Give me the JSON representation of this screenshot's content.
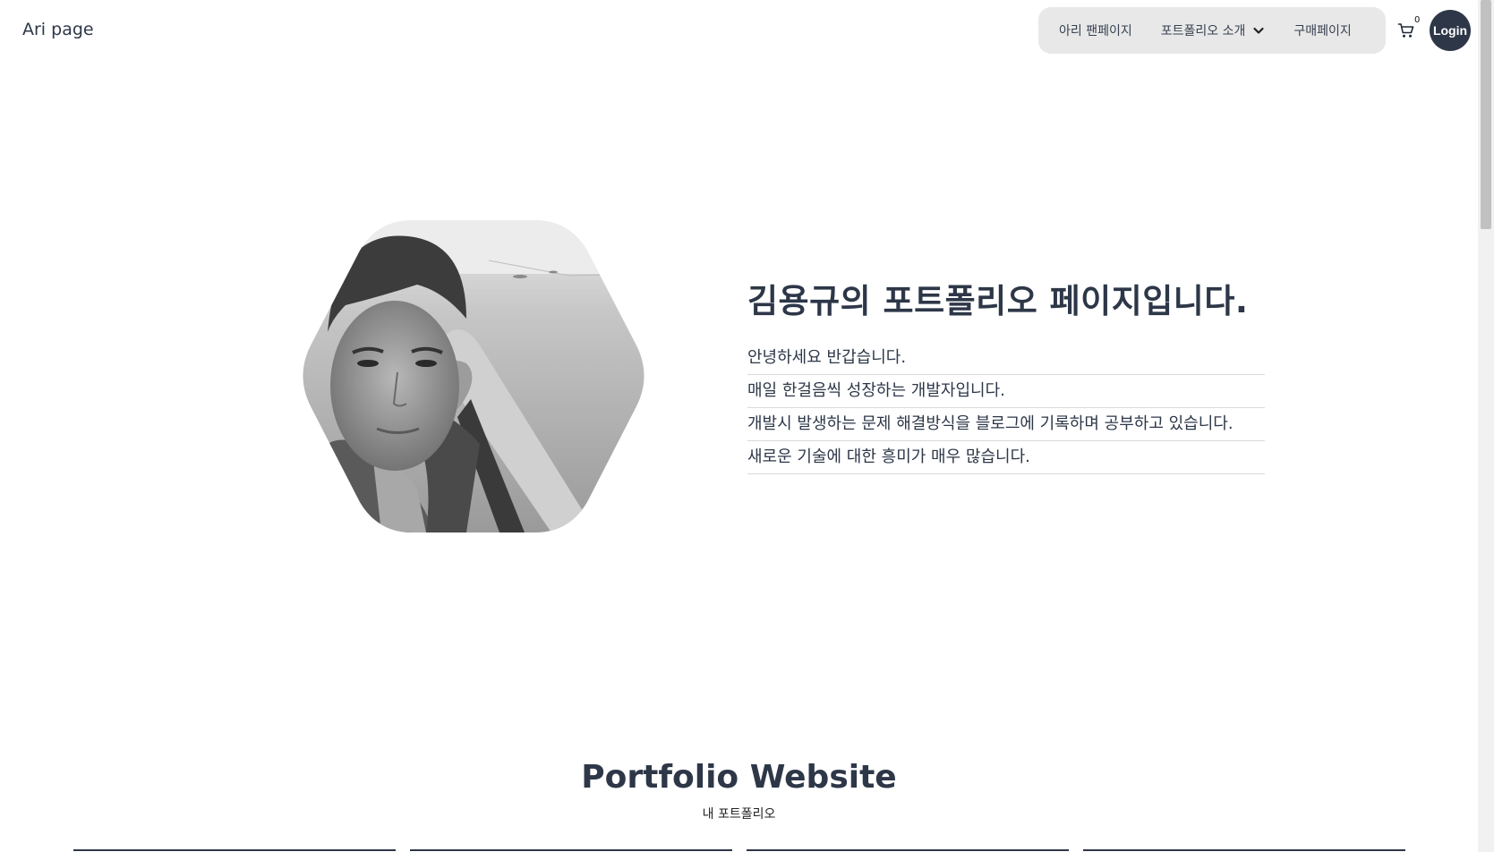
{
  "header": {
    "brand": "Ari page",
    "nav": [
      {
        "label": "아리 팬페이지"
      },
      {
        "label": "포트폴리오 소개",
        "has_dropdown": true
      },
      {
        "label": "구매페이지"
      }
    ],
    "cart_count": "0",
    "login_label": "Login"
  },
  "hero": {
    "title": "김용규의 포트폴리오 페이지입니다.",
    "lines": [
      "안녕하세요 반갑습니다.",
      "매일 한걸음씩 성장하는 개발자입니다.",
      "개발시 발생하는 문제 해결방식을 블로그에 기록하며 공부하고 있습니다.",
      "새로운 기술에 대한 흥미가 매우 많습니다."
    ]
  },
  "portfolio": {
    "title": "Portfolio Website",
    "subtitle": "내 포트폴리오"
  },
  "colors": {
    "text": "#2d3748",
    "nav_bg": "#e8e8e8",
    "login_bg": "#2d3748"
  }
}
